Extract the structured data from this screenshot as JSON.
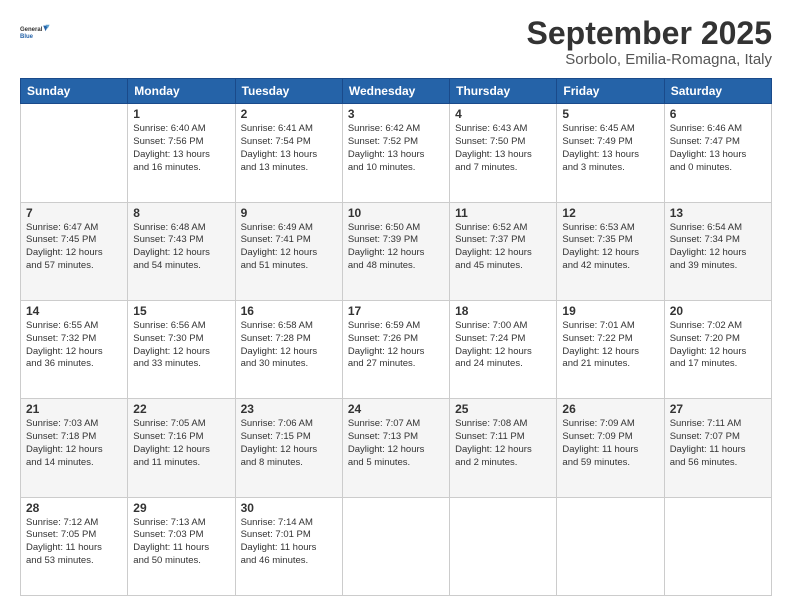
{
  "logo": {
    "line1": "General",
    "line2": "Blue"
  },
  "title": "September 2025",
  "subtitle": "Sorbolo, Emilia-Romagna, Italy",
  "headers": [
    "Sunday",
    "Monday",
    "Tuesday",
    "Wednesday",
    "Thursday",
    "Friday",
    "Saturday"
  ],
  "weeks": [
    [
      {
        "day": "",
        "info": ""
      },
      {
        "day": "1",
        "info": "Sunrise: 6:40 AM\nSunset: 7:56 PM\nDaylight: 13 hours\nand 16 minutes."
      },
      {
        "day": "2",
        "info": "Sunrise: 6:41 AM\nSunset: 7:54 PM\nDaylight: 13 hours\nand 13 minutes."
      },
      {
        "day": "3",
        "info": "Sunrise: 6:42 AM\nSunset: 7:52 PM\nDaylight: 13 hours\nand 10 minutes."
      },
      {
        "day": "4",
        "info": "Sunrise: 6:43 AM\nSunset: 7:50 PM\nDaylight: 13 hours\nand 7 minutes."
      },
      {
        "day": "5",
        "info": "Sunrise: 6:45 AM\nSunset: 7:49 PM\nDaylight: 13 hours\nand 3 minutes."
      },
      {
        "day": "6",
        "info": "Sunrise: 6:46 AM\nSunset: 7:47 PM\nDaylight: 13 hours\nand 0 minutes."
      }
    ],
    [
      {
        "day": "7",
        "info": "Sunrise: 6:47 AM\nSunset: 7:45 PM\nDaylight: 12 hours\nand 57 minutes."
      },
      {
        "day": "8",
        "info": "Sunrise: 6:48 AM\nSunset: 7:43 PM\nDaylight: 12 hours\nand 54 minutes."
      },
      {
        "day": "9",
        "info": "Sunrise: 6:49 AM\nSunset: 7:41 PM\nDaylight: 12 hours\nand 51 minutes."
      },
      {
        "day": "10",
        "info": "Sunrise: 6:50 AM\nSunset: 7:39 PM\nDaylight: 12 hours\nand 48 minutes."
      },
      {
        "day": "11",
        "info": "Sunrise: 6:52 AM\nSunset: 7:37 PM\nDaylight: 12 hours\nand 45 minutes."
      },
      {
        "day": "12",
        "info": "Sunrise: 6:53 AM\nSunset: 7:35 PM\nDaylight: 12 hours\nand 42 minutes."
      },
      {
        "day": "13",
        "info": "Sunrise: 6:54 AM\nSunset: 7:34 PM\nDaylight: 12 hours\nand 39 minutes."
      }
    ],
    [
      {
        "day": "14",
        "info": "Sunrise: 6:55 AM\nSunset: 7:32 PM\nDaylight: 12 hours\nand 36 minutes."
      },
      {
        "day": "15",
        "info": "Sunrise: 6:56 AM\nSunset: 7:30 PM\nDaylight: 12 hours\nand 33 minutes."
      },
      {
        "day": "16",
        "info": "Sunrise: 6:58 AM\nSunset: 7:28 PM\nDaylight: 12 hours\nand 30 minutes."
      },
      {
        "day": "17",
        "info": "Sunrise: 6:59 AM\nSunset: 7:26 PM\nDaylight: 12 hours\nand 27 minutes."
      },
      {
        "day": "18",
        "info": "Sunrise: 7:00 AM\nSunset: 7:24 PM\nDaylight: 12 hours\nand 24 minutes."
      },
      {
        "day": "19",
        "info": "Sunrise: 7:01 AM\nSunset: 7:22 PM\nDaylight: 12 hours\nand 21 minutes."
      },
      {
        "day": "20",
        "info": "Sunrise: 7:02 AM\nSunset: 7:20 PM\nDaylight: 12 hours\nand 17 minutes."
      }
    ],
    [
      {
        "day": "21",
        "info": "Sunrise: 7:03 AM\nSunset: 7:18 PM\nDaylight: 12 hours\nand 14 minutes."
      },
      {
        "day": "22",
        "info": "Sunrise: 7:05 AM\nSunset: 7:16 PM\nDaylight: 12 hours\nand 11 minutes."
      },
      {
        "day": "23",
        "info": "Sunrise: 7:06 AM\nSunset: 7:15 PM\nDaylight: 12 hours\nand 8 minutes."
      },
      {
        "day": "24",
        "info": "Sunrise: 7:07 AM\nSunset: 7:13 PM\nDaylight: 12 hours\nand 5 minutes."
      },
      {
        "day": "25",
        "info": "Sunrise: 7:08 AM\nSunset: 7:11 PM\nDaylight: 12 hours\nand 2 minutes."
      },
      {
        "day": "26",
        "info": "Sunrise: 7:09 AM\nSunset: 7:09 PM\nDaylight: 11 hours\nand 59 minutes."
      },
      {
        "day": "27",
        "info": "Sunrise: 7:11 AM\nSunset: 7:07 PM\nDaylight: 11 hours\nand 56 minutes."
      }
    ],
    [
      {
        "day": "28",
        "info": "Sunrise: 7:12 AM\nSunset: 7:05 PM\nDaylight: 11 hours\nand 53 minutes."
      },
      {
        "day": "29",
        "info": "Sunrise: 7:13 AM\nSunset: 7:03 PM\nDaylight: 11 hours\nand 50 minutes."
      },
      {
        "day": "30",
        "info": "Sunrise: 7:14 AM\nSunset: 7:01 PM\nDaylight: 11 hours\nand 46 minutes."
      },
      {
        "day": "",
        "info": ""
      },
      {
        "day": "",
        "info": ""
      },
      {
        "day": "",
        "info": ""
      },
      {
        "day": "",
        "info": ""
      }
    ]
  ]
}
